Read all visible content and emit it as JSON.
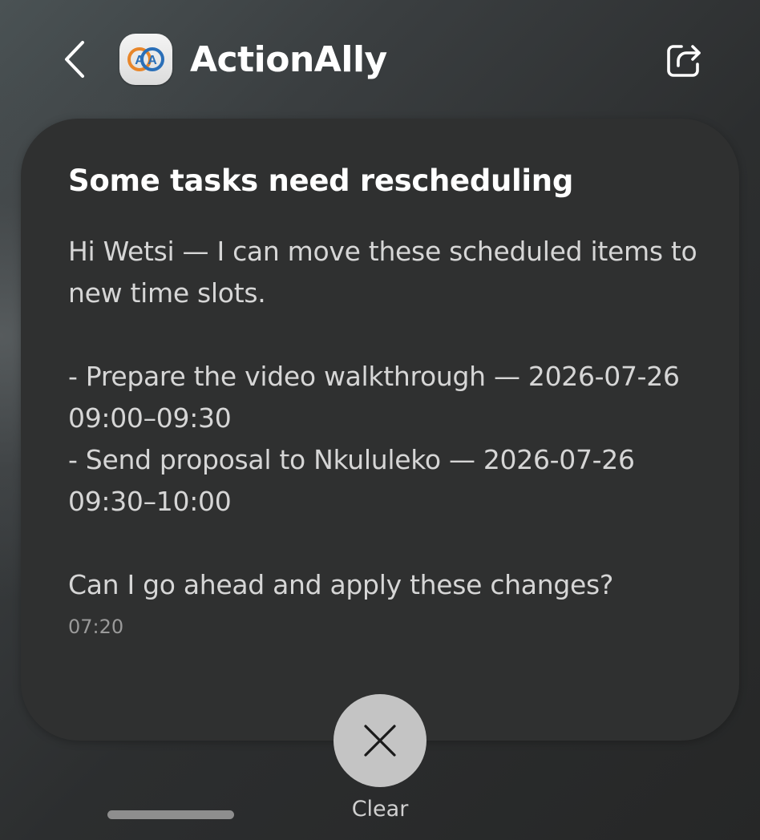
{
  "header": {
    "app_name": "ActionAlly",
    "logo_letters": "AA",
    "icons": {
      "back": "chevron-left-icon",
      "share": "share-icon"
    }
  },
  "card": {
    "title": "Some tasks need rescheduling",
    "greeting": "Hi Wetsi — I can move these scheduled items to new time slots.",
    "items": [
      "- Prepare the video walkthrough — 2026-07-26 09:00–09:30",
      "- Send proposal to Nkululeko — 2026-07-26 09:30–10:00"
    ],
    "question": "Can I go ahead and apply these changes?",
    "time": "07:20"
  },
  "actions": {
    "clear_label": "Clear",
    "clear_icon": "close-icon"
  },
  "colors": {
    "card_bg": "#2f3030",
    "clear_button_bg": "#c4c4c4",
    "logo_orange": "#e8862a",
    "logo_blue": "#2a6fb8"
  }
}
